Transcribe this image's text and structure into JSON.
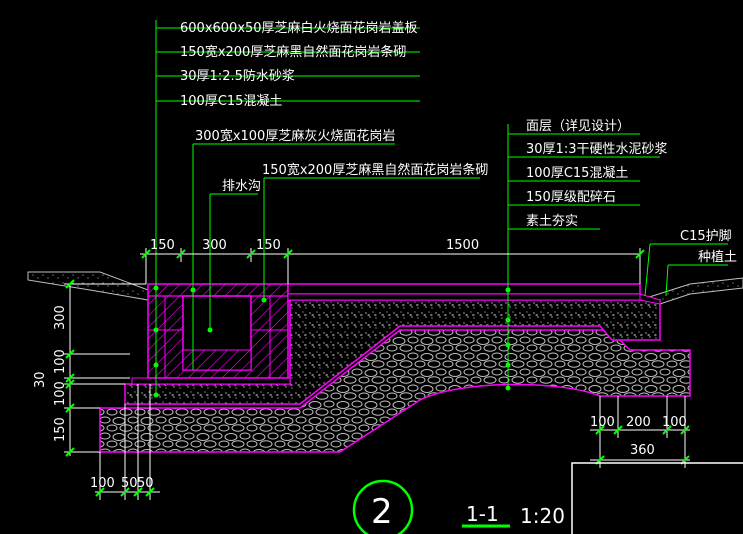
{
  "colors": {
    "background": "#000000",
    "leader": "#00ff00",
    "structure": "#ff00ff",
    "text": "#ffffff",
    "hatch": "#c0c0c0",
    "dim_tick": "#00ff00",
    "frame": "#ffffff"
  },
  "labels_left": [
    "600x600x50厚芝麻白火烧面花岗岩盖板",
    "150宽x200厚芝麻黑自然面花岗岩条砌",
    "30厚1:2.5防水砂浆",
    "100厚C15混凝土"
  ],
  "labels_mid": [
    "300宽x100厚芝麻灰火烧面花岗岩",
    "150宽x200厚芝麻黑自然面花岗岩条砌"
  ],
  "label_drain": "排水沟",
  "labels_right": [
    "面层（详见设计）",
    "30厚1:3干硬性水泥砂浆",
    "100厚C15混凝土",
    "150厚级配碎石",
    "素土夯实"
  ],
  "label_c15": "C15护脚",
  "label_soil": "种植土",
  "dims_top": [
    "150",
    "300",
    "150",
    "1500"
  ],
  "dims_left": [
    "300",
    "100",
    "30",
    "100",
    "150"
  ],
  "dims_bottom_left": [
    "100",
    "50",
    "50"
  ],
  "dims_bottom_right": [
    "100",
    "200",
    "100"
  ],
  "dim_total_right": "360",
  "section_number": "2",
  "section_title": "1-1",
  "scale": "1:20"
}
